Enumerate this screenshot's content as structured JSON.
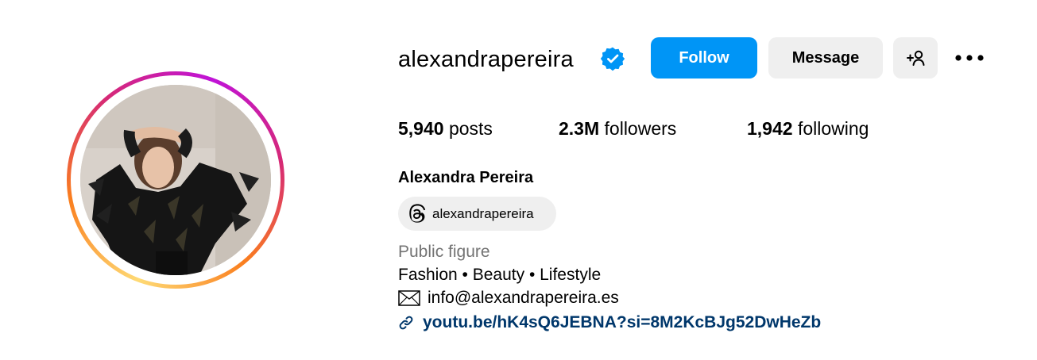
{
  "profile": {
    "username": "alexandrapereira",
    "verified": true,
    "full_name": "Alexandra Pereira",
    "threads_handle": "alexandrapereira",
    "category": "Public figure",
    "bio": "Fashion • Beauty • Lifestyle",
    "email": "info@alexandrapereira.es",
    "link": "youtu.be/hK4sQ6JEBNA?si=8M2KcBJg52DwHeZb"
  },
  "actions": {
    "follow_label": "Follow",
    "message_label": "Message"
  },
  "stats": {
    "posts_count": "5,940",
    "posts_label": "posts",
    "followers_count": "2.3M",
    "followers_label": "followers",
    "following_count": "1,942",
    "following_label": "following"
  },
  "icons": {
    "verified": "verified-badge-icon",
    "add_user": "add-user-icon",
    "more": "more-options-icon",
    "threads": "threads-icon",
    "mail": "mail-icon",
    "link": "link-icon"
  },
  "colors": {
    "follow_button": "#0095f6",
    "secondary_button": "#efefef",
    "verified_badge": "#0095f6",
    "link_text": "#00376b",
    "category_text": "#737373"
  }
}
